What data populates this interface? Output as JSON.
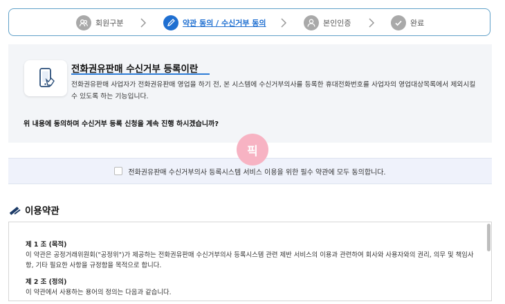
{
  "steps": [
    {
      "label": "회원구분",
      "icon": "users-icon",
      "active": false
    },
    {
      "label": "약관 동의 / 수신거부 동의",
      "icon": "pencil-icon",
      "active": true
    },
    {
      "label": "본인인증",
      "icon": "user-icon",
      "active": false
    },
    {
      "label": "완료",
      "icon": "check-icon",
      "active": false
    }
  ],
  "intro": {
    "title": "전화권유판매 수신거부 등록이란",
    "desc": "전화권유판매 사업자가 전화권유판매 영업을 하기 전, 본 시스템에 수신거부의사를 등록한 휴대전화번호를 사업자의 영업대상목록에서 제외시킬 수 있도록 하는 기능입니다.",
    "question": "위 내용에 동의하며 수신거부 등록 신청을 계속 진행 하시겠습니까?"
  },
  "badge": "픽",
  "agree": {
    "label": "전화권유판매 수신거부의사 등록시스템 서비스 이용을 위한 필수 약관에 모두 동의합니다.",
    "checked": false
  },
  "terms": {
    "heading": "이용약관",
    "sections": [
      {
        "title": "제 1 조 (목적)",
        "body": "이 약관은 공정거래위원회(\"공정위\")가 제공하는 전화권유판매 수신거부의사 등록시스템 관련 제반 서비스의 이용과 관련하여 회사와 사용자와의 권리, 의무 및 책임사항, 기타 필요한 사항을 규정함을 목적으로 합니다."
      },
      {
        "title": "제 2 조 (정의)",
        "body": "이 약관에서 사용하는 용어의 정의는 다음과 같습니다."
      }
    ]
  },
  "colors": {
    "accent": "#1f6fd1",
    "inactive": "#a9a9a9",
    "badge": "#f7b3c3"
  }
}
